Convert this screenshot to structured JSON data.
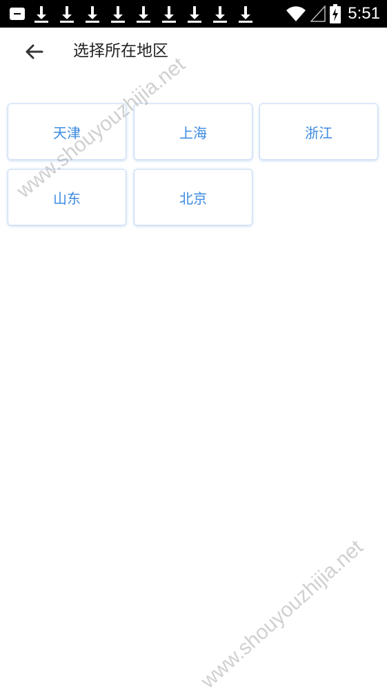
{
  "status_bar": {
    "time": "5:51",
    "notification_icons": [
      "notification-icon",
      "download-icon",
      "download-icon",
      "download-icon",
      "download-icon",
      "download-icon",
      "download-icon",
      "download-icon",
      "download-icon",
      "download-icon"
    ],
    "right_icons": [
      "wifi-icon",
      "cellular-signal-icon",
      "battery-charging-icon"
    ]
  },
  "header": {
    "back_icon": "arrow-left-icon",
    "title": "选择所在地区"
  },
  "regions": [
    "天津",
    "上海",
    "浙江",
    "山东",
    "北京"
  ],
  "watermark": {
    "text": "www.shouyouzhijia.net"
  },
  "colors": {
    "accent": "#3a89e0",
    "status_bar": "#000000",
    "background": "#ffffff"
  }
}
